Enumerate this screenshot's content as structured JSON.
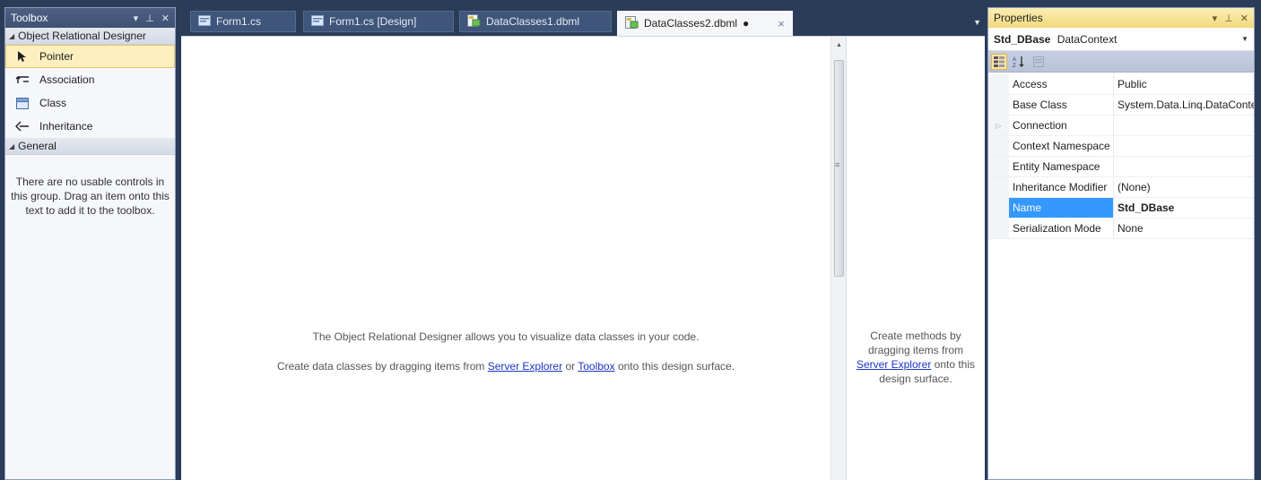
{
  "toolbox": {
    "title": "Toolbox",
    "groups": [
      {
        "label": "Object Relational Designer",
        "items": [
          {
            "label": "Pointer",
            "icon": "pointer-icon"
          },
          {
            "label": "Association",
            "icon": "association-icon"
          },
          {
            "label": "Class",
            "icon": "class-icon"
          },
          {
            "label": "Inheritance",
            "icon": "inheritance-icon"
          }
        ]
      },
      {
        "label": "General",
        "empty_message": "There are no usable controls in this group. Drag an item onto this text to add it to the toolbox."
      }
    ]
  },
  "tabs": [
    {
      "label": "Form1.cs",
      "icon": "code-file-icon"
    },
    {
      "label": "Form1.cs [Design]",
      "icon": "form-design-icon"
    },
    {
      "label": "DataClasses1.dbml",
      "icon": "dbml-icon"
    },
    {
      "label": "DataClasses2.dbml",
      "icon": "dbml-icon",
      "modified_marker": "●",
      "close": "×",
      "active": true
    }
  ],
  "designer": {
    "line1": "The Object Relational Designer allows you to visualize data classes in your code.",
    "line2_pre": "Create data classes by dragging items from ",
    "line2_link1": "Server Explorer",
    "line2_mid": " or ",
    "line2_link2": "Toolbox",
    "line2_post": " onto this design surface.",
    "methods_pre": "Create methods by dragging items from ",
    "methods_link": "Server Explorer",
    "methods_post": " onto this design surface."
  },
  "properties": {
    "title": "Properties",
    "object_name": "Std_DBase",
    "object_type": "DataContext",
    "rows": [
      {
        "name": "Access",
        "value": "Public"
      },
      {
        "name": "Base Class",
        "value": "System.Data.Linq.DataContext"
      },
      {
        "name": "Connection",
        "value": "",
        "expandable": true
      },
      {
        "name": "Context Namespace",
        "value": ""
      },
      {
        "name": "Entity Namespace",
        "value": ""
      },
      {
        "name": "Inheritance Modifier",
        "value": "(None)"
      },
      {
        "name": "Name",
        "value": "Std_DBase",
        "selected": true
      },
      {
        "name": "Serialization Mode",
        "value": "None"
      }
    ]
  },
  "colors": {
    "ide_background": "#2b3c59",
    "selection_blue": "#3399ff",
    "hover_yellow": "#fdf0be",
    "link_blue": "#1a36c4"
  }
}
